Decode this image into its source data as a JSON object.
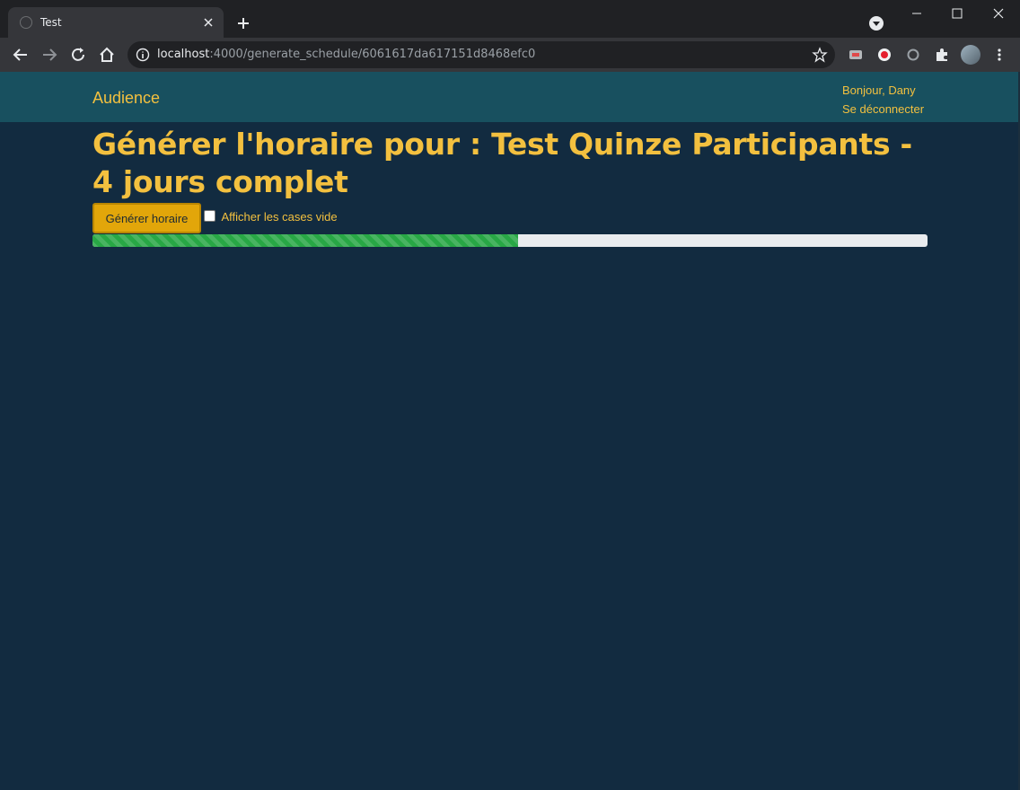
{
  "browser": {
    "tab_title": "Test",
    "url_host": "localhost",
    "url_path": ":4000/generate_schedule/6061617da617151d8468efc0"
  },
  "navbar": {
    "brand": "Audience",
    "greeting": "Bonjour, Dany",
    "logout": "Se déconnecter"
  },
  "main": {
    "title": "Générer l'horaire pour : Test Quinze Participants - 4 jours complet",
    "generate_button": "Générer horaire",
    "show_empty_label": "Afficher les cases vide",
    "show_empty_checked": false,
    "progress_fraction": 0.51,
    "progress_color": "#28a745"
  },
  "colors": {
    "accent": "#f3c03f",
    "navbar_bg": "#18505f",
    "page_bg": "#122b40",
    "button_bg": "#e2a60a"
  }
}
